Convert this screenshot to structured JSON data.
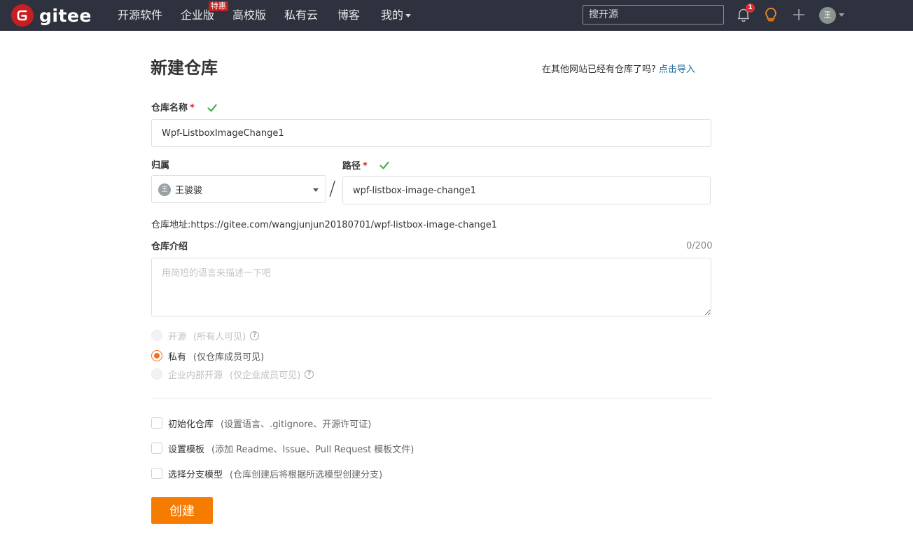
{
  "nav": {
    "logo_text": "gitee",
    "items": [
      {
        "label": "开源软件"
      },
      {
        "label": "企业版"
      },
      {
        "label": "高校版"
      },
      {
        "label": "私有云"
      },
      {
        "label": "博客"
      },
      {
        "label": "我的"
      }
    ],
    "enterprise_badge": "特惠",
    "search_placeholder": "搜开源",
    "notification_count": "1",
    "avatar_initial": "王"
  },
  "form": {
    "title": "新建仓库",
    "import_hint": "在其他网站已经有仓库了吗?",
    "import_link": "点击导入",
    "repo_name_label": "仓库名称",
    "required_mark": "*",
    "repo_name_value": "Wpf-ListboxImageChange1",
    "owner_label": "归属",
    "owner_initial": "王",
    "owner_name": "王骏骏",
    "slash": "/",
    "path_label": "路径",
    "path_value": "wpf-listbox-image-change1",
    "address_label": "仓库地址:",
    "address_value": "https://gitee.com/wangjunjun20180701/wpf-listbox-image-change1",
    "intro_label": "仓库介绍",
    "intro_counter": "0/200",
    "intro_placeholder": "用简短的语言来描述一下吧",
    "visibility": [
      {
        "label": "开源",
        "sub": "(所有人可见)",
        "selected": false,
        "disabled": true,
        "help": true
      },
      {
        "label": "私有",
        "sub": "(仅仓库成员可见)",
        "selected": true,
        "disabled": false,
        "help": false
      },
      {
        "label": "企业内部开源",
        "sub": "(仅企业成员可见)",
        "selected": false,
        "disabled": true,
        "help": true
      }
    ],
    "options": [
      {
        "label": "初始化仓库",
        "sub": "(设置语言、.gitignore、开源许可证)"
      },
      {
        "label": "设置模板",
        "sub": "(添加 Readme、Issue、Pull Request 模板文件)"
      },
      {
        "label": "选择分支模型",
        "sub": "(仓库创建后将根据所选模型创建分支)"
      }
    ],
    "submit_label": "创建"
  },
  "colors": {
    "nav_bg": "#2e323e",
    "accent": "#f57c00",
    "brand": "#c71d23",
    "valid": "#4caf50"
  }
}
